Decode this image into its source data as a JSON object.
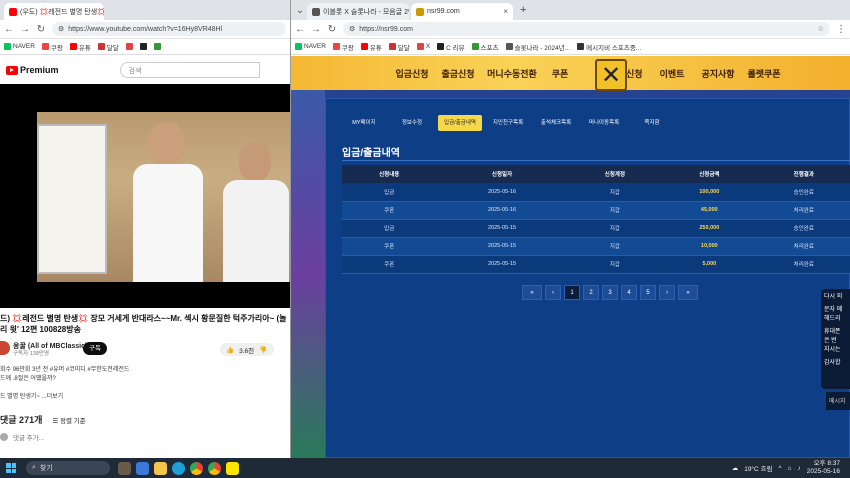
{
  "left_window": {
    "tabs": [
      {
        "label": "(우도) 💢레전드 별명 탄생💢 ...",
        "active": true
      }
    ],
    "url": "https://www.youtube.com/watch?v=16Hy8VR48Hl",
    "bookmarks": [
      "NAVER",
      "쿠팡",
      "유튜",
      "달달",
      "",
      "",
      "",
      "",
      "",
      "",
      ""
    ],
    "logo_text": "Premium",
    "search_placeholder": "검색",
    "video_title": "드) 💢레전드 별명 탄생💢 장모 거세게 반대라스~~Mr. 섹시 황문질한 턱주가리아~ (놀리 윗' 12편 100828방송",
    "channel_name": "옹꿀 (All of MBClassic)",
    "channel_subs": "구독자 138만명",
    "subscribe_label": "구독",
    "like_count": "3.6천",
    "description_lines": [
      "회수 96만회 3년 전 #유머 #코미디 #무한도전레전드",
      "드께 .8절은 어땠을까?",
      "",
      "드 별명 탄생기~ ...더보기"
    ],
    "comments_count": "댓글 271개",
    "sort_label": "정렬 기준",
    "comment_placeholder": "댓글 추가..."
  },
  "right_window": {
    "tabs": [
      {
        "label": "이블롯 X 슬롯나라 - 모음글 2만",
        "active": false
      },
      {
        "label": "nsr99.com",
        "active": true
      }
    ],
    "url": "https://nsr99.com",
    "bookmarks": [
      "NAVER",
      "쿠팡",
      "유튜",
      "달달",
      "X",
      "C 리뷰",
      "스포츠",
      "슬롯나라 - 2024년...",
      "메시지비 스포츠중..."
    ],
    "main_nav": [
      "입금신청",
      "출금신청",
      "머니수동전환",
      "쿠폰",
      "",
      "콤프신청",
      "이벤트",
      "공지사항",
      "롤렛쿠폰"
    ],
    "sub_tabs": [
      "MY페이지",
      "정보수정",
      "입금/출금내역",
      "지인친구목록",
      "출석체크목록",
      "머니이동목록",
      "쪽지함"
    ],
    "active_sub_tab": 2,
    "section_title": "입금/출금내역",
    "table_headers": [
      "신청내용",
      "신청일자",
      "신청계정",
      "신청금액",
      "진행결과"
    ],
    "table_rows": [
      [
        "입금",
        "2025-05-16",
        "지갑",
        "100,000",
        "승인완료"
      ],
      [
        "쿠폰",
        "2025-05-16",
        "지갑",
        "45,000",
        "처리완료"
      ],
      [
        "입금",
        "2025-05-15",
        "지갑",
        "250,000",
        "승인완료"
      ],
      [
        "쿠폰",
        "2025-05-15",
        "지갑",
        "10,000",
        "처리완료"
      ],
      [
        "쿠폰",
        "2025-05-15",
        "지갑",
        "5,000",
        "처리완료"
      ]
    ],
    "pagination": [
      "«",
      "‹",
      "1",
      "2",
      "3",
      "4",
      "5",
      "›",
      "»"
    ],
    "active_page": "1",
    "chat_lines": [
      "다시 외",
      "",
      "문자 메",
      "해드리",
      "",
      "휴대폰",
      "은 번",
      "지시는",
      "",
      "감사합"
    ],
    "chat_input": "메시지"
  },
  "taskbar": {
    "search_label": "찾기",
    "weather": "19°C 흐림",
    "time": "오후 8:37",
    "date": "2025-05-16"
  }
}
